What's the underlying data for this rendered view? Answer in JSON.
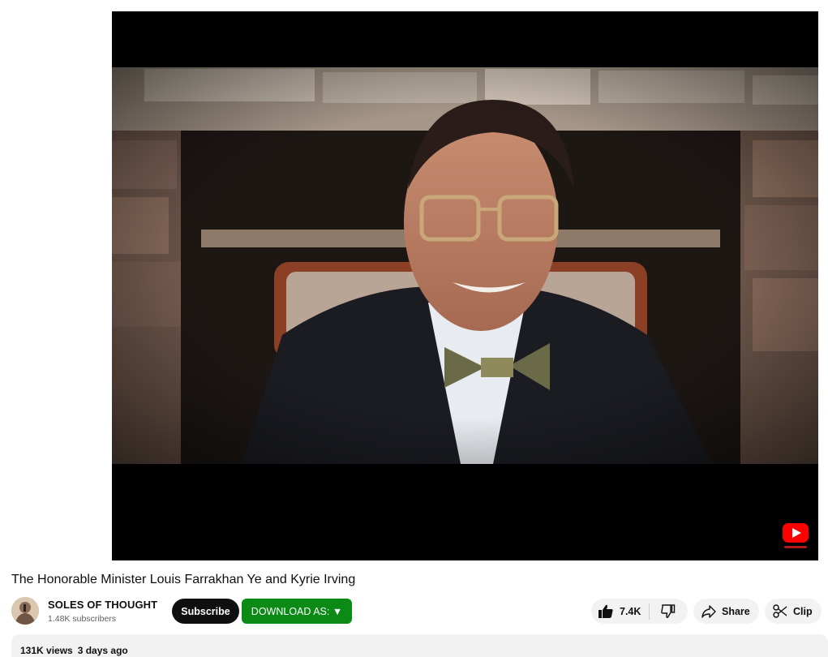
{
  "video": {
    "title": "The Honorable Minister Louis Farrakhan Ye and Kyrie Irving",
    "watermark_icon": "youtube-subscribe-icon"
  },
  "channel": {
    "name": "SOLES OF THOUGHT",
    "subscribers": "1.48K subscribers",
    "avatar_icon": "channel-avatar"
  },
  "actions": {
    "subscribe_label": "Subscribe",
    "download_label": "DOWNLOAD AS: ▼",
    "like_count": "7.4K",
    "share_label": "Share",
    "clip_label": "Clip"
  },
  "description": {
    "views": "131K views",
    "date": "3 days ago"
  },
  "colors": {
    "download_button": "#0b8a15",
    "subscribe_button": "#0f0f0f",
    "pill_background": "#f2f2f2",
    "youtube_red": "#ff0000"
  }
}
